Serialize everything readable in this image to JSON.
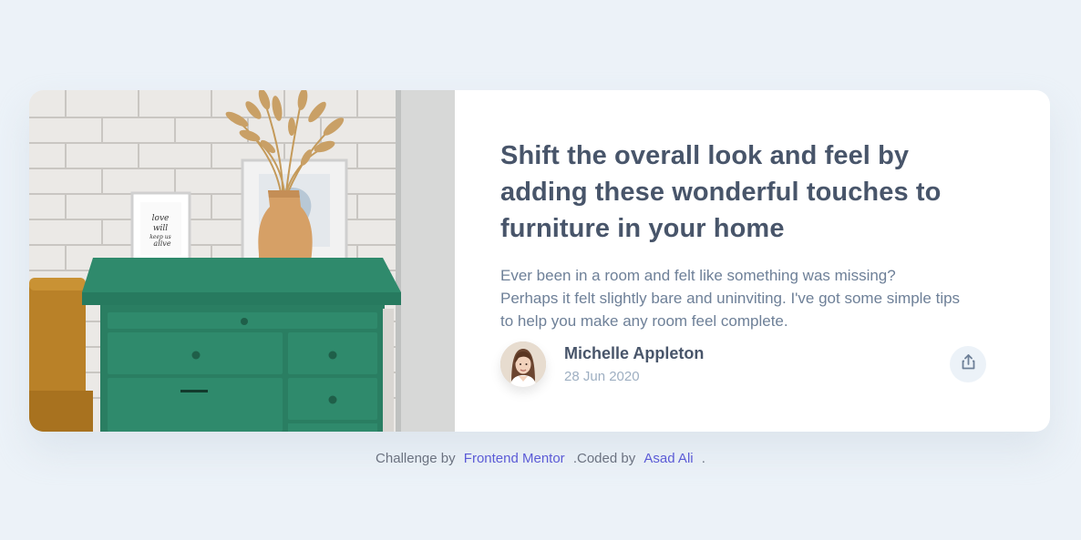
{
  "article": {
    "title": "Shift the overall look and feel by adding these wonderful touches to furniture in your home",
    "description_lines": [
      "Ever been in a room and felt like something was missing?",
      "Perhaps it felt slightly bare and uninviting. I've got some simple tips",
      "to help you make any room feel complete."
    ],
    "image": "drawers",
    "frame_text": [
      "love",
      "will",
      "keep us",
      "alive"
    ]
  },
  "author": {
    "name": "Michelle Appleton",
    "date": "28 Jun 2020",
    "avatar": "avatar-michelle"
  },
  "share": {
    "icon": "share-icon"
  },
  "attribution": {
    "prefix": "Challenge by",
    "challenge_link": "Frontend Mentor",
    "middle": ".Coded by",
    "author_link": "Asad Ali",
    "suffix": "."
  },
  "colors": {
    "background": "#ecf2f8",
    "card": "#ffffff",
    "title": "#48556a",
    "text": "#6e8098",
    "muted": "#9eafc2",
    "link": "#5b5bd6"
  }
}
